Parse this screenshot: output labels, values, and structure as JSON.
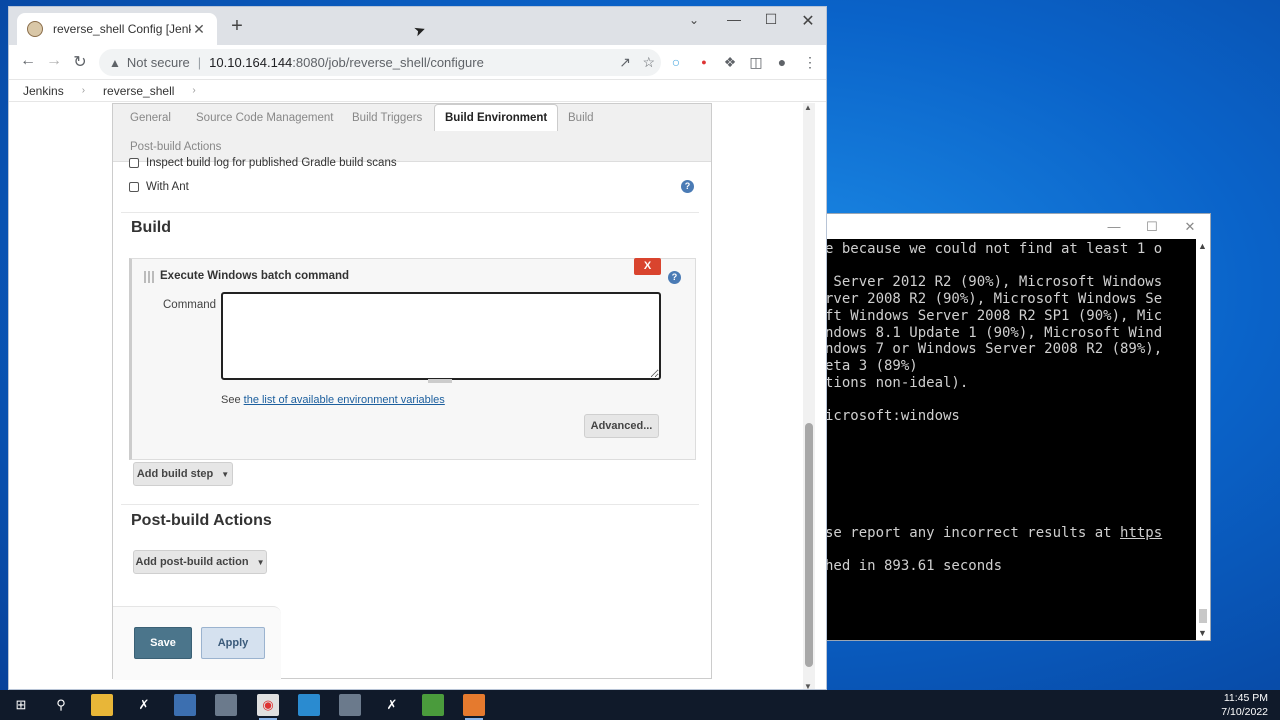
{
  "terminal": {
    "lines": [
      {
        "text": "e because we could not find at least 1 o"
      },
      {
        "text": ""
      },
      {
        "text": " Server 2012 R2 (90%), Microsoft Windows"
      },
      {
        "text": "rver 2008 R2 (90%), Microsoft Windows Se"
      },
      {
        "text": "ft Windows Server 2008 R2 SP1 (90%), Mic"
      },
      {
        "text": "ndows 8.1 Update 1 (90%), Microsoft Wind"
      },
      {
        "text": "ndows 7 or Windows Server 2008 R2 (89%),"
      },
      {
        "text": "eta 3 (89%)"
      },
      {
        "text": "tions non-ideal)."
      },
      {
        "text": ""
      },
      {
        "text": "icrosoft:windows"
      },
      {
        "text": ""
      },
      {
        "text": ""
      },
      {
        "text": ""
      },
      {
        "text": ""
      },
      {
        "text": ""
      },
      {
        "text": ""
      },
      {
        "text": "se report any incorrect results at ",
        "link": "https"
      },
      {
        "text": ""
      },
      {
        "text": "hed in 893.61 seconds"
      }
    ]
  },
  "browser": {
    "tab_title": "reverse_shell Config [Jenkins]",
    "url_security": "Not secure",
    "url_host": "10.10.164.144",
    "url_path": ":8080/job/reverse_shell/configure"
  },
  "breadcrumbs": [
    "Jenkins",
    "reverse_shell"
  ],
  "config_tabs": {
    "general": "General",
    "scm": "Source Code Management",
    "triggers": "Build Triggers",
    "build_env": "Build Environment",
    "build": "Build",
    "post_build": "Post-build Actions"
  },
  "build_env": {
    "gradle_option": "Inspect build log for published Gradle build scans",
    "ant_option": "With Ant"
  },
  "build_section": {
    "title": "Build",
    "step_title": "Execute Windows batch command",
    "delete_label": "X",
    "command_label": "Command",
    "command_value": "",
    "env_prefix": "See ",
    "env_link": "the list of available environment variables",
    "advanced_label": "Advanced...",
    "add_step_label": "Add build step"
  },
  "post_build_section": {
    "title": "Post-build Actions",
    "add_action_label": "Add post-build action"
  },
  "buttons": {
    "save": "Save",
    "apply": "Apply"
  },
  "taskbar": {
    "time": "11:45 PM",
    "date": "7/10/2022"
  },
  "colors": {
    "save_button": "#4b758b",
    "delete_button": "#d9442e",
    "link": "#1c5f9e",
    "desktop": "#0a63c9"
  }
}
